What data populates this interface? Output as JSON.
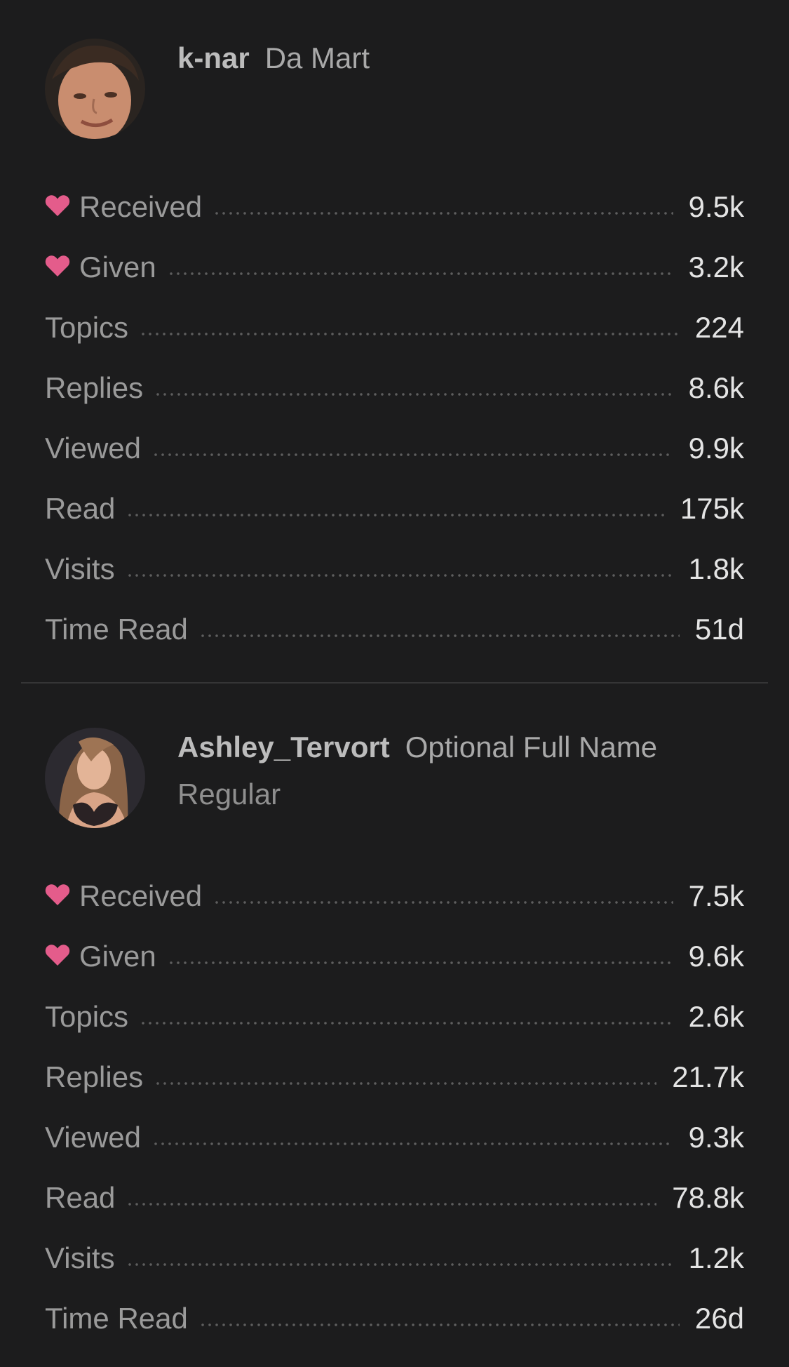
{
  "users": [
    {
      "username": "k-nar",
      "full_name": "Da Mart",
      "title": "",
      "avatar_icon": "user-avatar-photo",
      "stats": {
        "received": {
          "label": "Received",
          "value": "9.5k",
          "icon": "heart-icon"
        },
        "given": {
          "label": "Given",
          "value": "3.2k",
          "icon": "heart-icon"
        },
        "topics": {
          "label": "Topics",
          "value": "224"
        },
        "replies": {
          "label": "Replies",
          "value": "8.6k"
        },
        "viewed": {
          "label": "Viewed",
          "value": "9.9k"
        },
        "read": {
          "label": "Read",
          "value": "175k"
        },
        "visits": {
          "label": "Visits",
          "value": "1.8k"
        },
        "time_read": {
          "label": "Time Read",
          "value": "51d"
        }
      }
    },
    {
      "username": "Ashley_Tervort",
      "full_name": "Optional Full Name",
      "title": "Regular",
      "avatar_icon": "user-avatar-photo",
      "stats": {
        "received": {
          "label": "Received",
          "value": "7.5k",
          "icon": "heart-icon"
        },
        "given": {
          "label": "Given",
          "value": "9.6k",
          "icon": "heart-icon"
        },
        "topics": {
          "label": "Topics",
          "value": "2.6k"
        },
        "replies": {
          "label": "Replies",
          "value": "21.7k"
        },
        "viewed": {
          "label": "Viewed",
          "value": "9.3k"
        },
        "read": {
          "label": "Read",
          "value": "78.8k"
        },
        "visits": {
          "label": "Visits",
          "value": "1.2k"
        },
        "time_read": {
          "label": "Time Read",
          "value": "26d"
        }
      }
    }
  ],
  "colors": {
    "background": "#1c1c1d",
    "heart": "#e45c8b",
    "divider": "#353536",
    "value_text": "#e4e4e4",
    "label_text": "#9a9a9a"
  }
}
